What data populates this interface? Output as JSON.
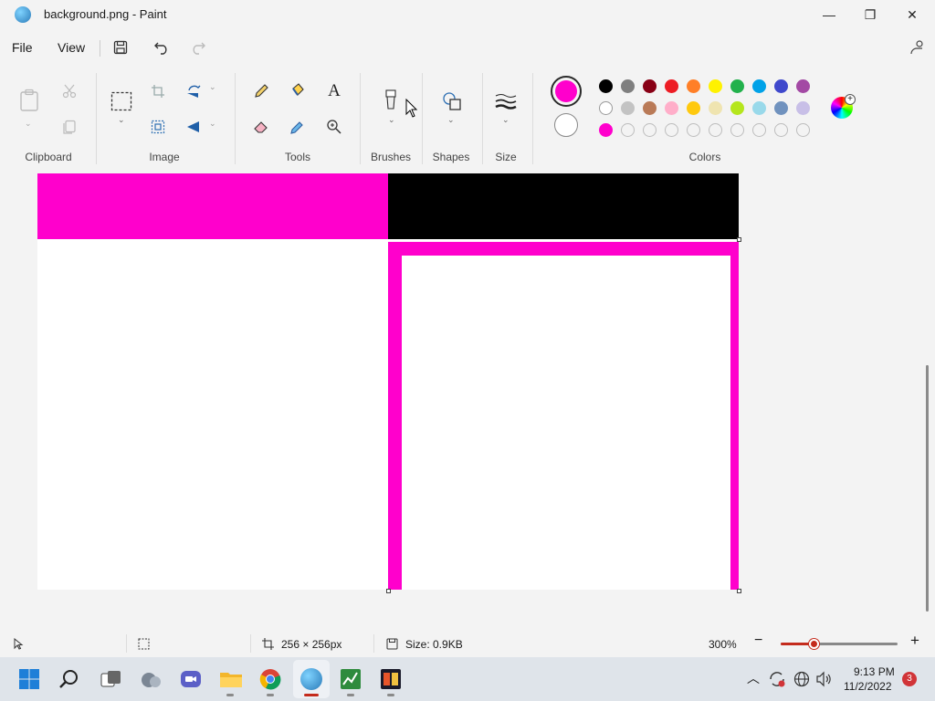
{
  "window": {
    "title": "background.png - Paint",
    "minimize_label": "—",
    "restore_label": "❐",
    "close_label": "✕"
  },
  "menu": {
    "file": "File",
    "view": "View"
  },
  "ribbon": {
    "groups": {
      "clipboard": "Clipboard",
      "image": "Image",
      "tools": "Tools",
      "brushes": "Brushes",
      "shapes": "Shapes",
      "size": "Size",
      "colors": "Colors"
    }
  },
  "colors": {
    "primary": "#ff00cc",
    "secondary": "#ffffff",
    "row1": [
      "#000000",
      "#7f7f7f",
      "#880015",
      "#ed1c24",
      "#ff7f27",
      "#fff200",
      "#22b14c",
      "#00a2e8",
      "#3f48cc",
      "#a349a4"
    ],
    "row2": [
      "#ffffff",
      "#c3c3c3",
      "#b97a57",
      "#ffaec9",
      "#ffc90e",
      "#efe4b0",
      "#b5e61d",
      "#99d9ea",
      "#7092be",
      "#c8bfe7"
    ],
    "row3": [
      "#ff00cc",
      "",
      "",
      "",
      "",
      "",
      "",
      "",
      "",
      ""
    ]
  },
  "status": {
    "dimensions": "256 × 256px",
    "size": "Size: 0.9KB",
    "zoom": "300%",
    "zoom_level": 0.29
  },
  "taskbar": {
    "time": "9:13 PM",
    "date": "11/2/2022",
    "badge": "3"
  }
}
